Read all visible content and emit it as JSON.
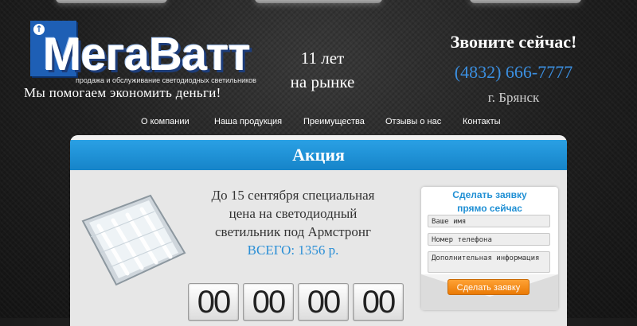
{
  "header": {
    "logo_text": "МегаВатт",
    "logo_subtitle": "продажа и обслуживание светодиодных светильников",
    "slogan": "Мы помогаем экономить деньги!",
    "years_line1": "11 лет",
    "years_line2": "на рынке",
    "call_label": "Звоните сейчас!",
    "phone": "(4832) 666-7777",
    "city": "г. Брянск"
  },
  "nav": {
    "items": [
      {
        "label": "О компании"
      },
      {
        "label": "Наша продукция"
      },
      {
        "label": "Преимущества"
      },
      {
        "label": "Отзывы о нас"
      },
      {
        "label": "Контакты"
      }
    ]
  },
  "promo": {
    "title": "Акция",
    "line1": "До 15 сентября специальная",
    "line2": "цена на светодиодный",
    "line3": "светильник под Армстронг",
    "price": "ВСЕГО: 1356 р."
  },
  "countdown": {
    "digits": [
      "00",
      "00",
      "00",
      "00"
    ]
  },
  "form": {
    "title_line1": "Сделать заявку",
    "title_line2": "прямо сейчас",
    "name_placeholder": "Ваше имя",
    "phone_placeholder": "Номер телефона",
    "info_placeholder": "Дополнительная информация",
    "submit_label": "Сделать заявку"
  },
  "colors": {
    "accent_blue": "#1f8fd4",
    "button_orange": "#f08a10",
    "logo_blue": "#1e5fb5"
  }
}
